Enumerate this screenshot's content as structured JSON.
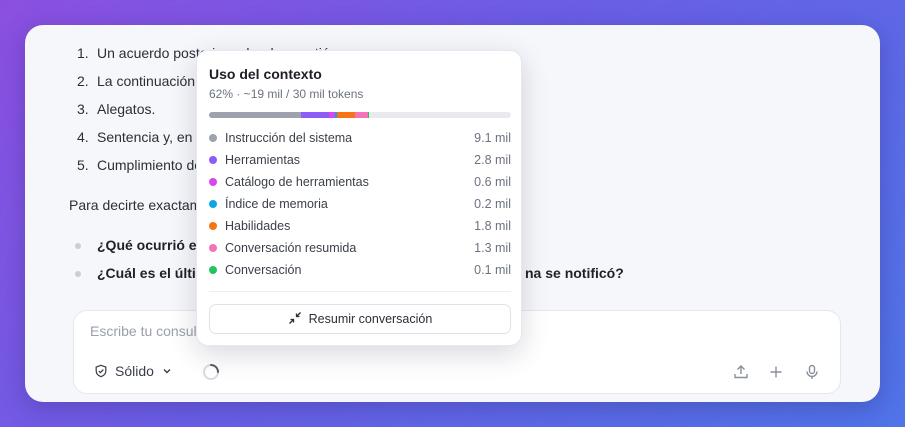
{
  "chat": {
    "steps": [
      {
        "num": "1.",
        "text": "Un acuerdo posterior sobre la cuestión"
      },
      {
        "num": "2.",
        "text": "La continuación del proceso"
      },
      {
        "num": "3.",
        "text": "Alegatos."
      },
      {
        "num": "4.",
        "text": "Sentencia y, en su caso"
      },
      {
        "num": "5.",
        "text": "Cumplimiento de la sentencia"
      }
    ],
    "paragraph": "Para decirte exactamente en qué etapa estás",
    "questions": [
      {
        "text": "¿Qué ocurrió en la última audiencia?"
      },
      {
        "text": "¿Cuál es el último acuerdo y en qué fecha"
      }
    ],
    "question2_tail": "na se notificó?"
  },
  "composer": {
    "placeholder": "Escribe tu consulta",
    "mode_label": "Sólido"
  },
  "context_popup": {
    "title": "Uso del contexto",
    "subtitle": "62% · ~19 mil / 30 mil tokens",
    "usage_percent": 62,
    "items": [
      {
        "label": "Instrucción del sistema",
        "value": "9.1 mil",
        "tokens_k": 9.1,
        "color": "#9ca3af"
      },
      {
        "label": "Herramientas",
        "value": "2.8 mil",
        "tokens_k": 2.8,
        "color": "#8b5cf6"
      },
      {
        "label": "Catálogo de herramientas",
        "value": "0.6 mil",
        "tokens_k": 0.6,
        "color": "#d946ef"
      },
      {
        "label": "Índice de memoria",
        "value": "0.2 mil",
        "tokens_k": 0.2,
        "color": "#0ea5e9"
      },
      {
        "label": "Habilidades",
        "value": "1.8 mil",
        "tokens_k": 1.8,
        "color": "#f97316"
      },
      {
        "label": "Conversación resumida",
        "value": "1.3 mil",
        "tokens_k": 1.3,
        "color": "#f472b6"
      },
      {
        "label": "Conversación",
        "value": "0.1 mil",
        "tokens_k": 0.1,
        "color": "#22c55e"
      }
    ],
    "total_tokens_k": 30,
    "summarize_label": "Resumir conversación"
  },
  "icons": [
    "shield-check-icon",
    "chevron-down-icon",
    "loading-spinner-icon",
    "upload-icon",
    "plus-icon",
    "microphone-icon",
    "collapse-arrows-icon"
  ]
}
